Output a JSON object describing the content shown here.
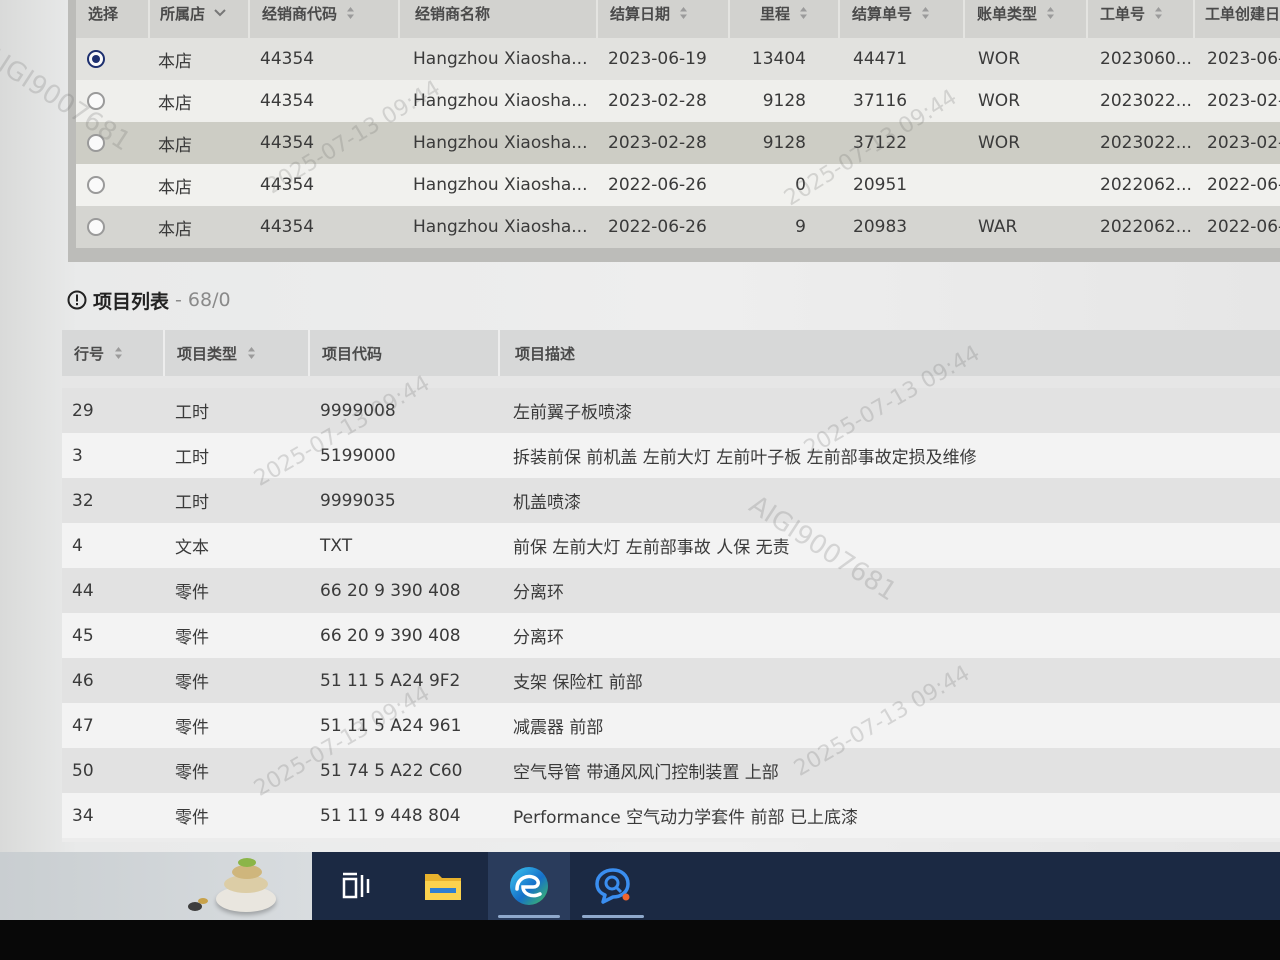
{
  "top_table": {
    "columns": [
      {
        "label": "选择",
        "sortable": false,
        "filter": false
      },
      {
        "label": "所属店",
        "sortable": false,
        "filter": true
      },
      {
        "label": "经销商代码",
        "sortable": true,
        "filter": false
      },
      {
        "label": "经销商名称",
        "sortable": false,
        "filter": false
      },
      {
        "label": "结算日期",
        "sortable": true,
        "filter": false
      },
      {
        "label": "里程",
        "sortable": true,
        "filter": false
      },
      {
        "label": "结算单号",
        "sortable": true,
        "filter": false
      },
      {
        "label": "账单类型",
        "sortable": true,
        "filter": false
      },
      {
        "label": "工单号",
        "sortable": true,
        "filter": false
      },
      {
        "label": "工单创建日",
        "sortable": false,
        "filter": false
      }
    ],
    "rows": [
      {
        "selected": true,
        "store": "本店",
        "dealer_code": "44354",
        "dealer_name": "Hangzhou Xiaosha...",
        "settle_date": "2023-06-19",
        "mileage": "13404",
        "settle_no": "44471",
        "bill_type": "WOR",
        "wo_no": "2023060...",
        "wo_created": "2023-06-"
      },
      {
        "selected": false,
        "store": "本店",
        "dealer_code": "44354",
        "dealer_name": "Hangzhou Xiaosha...",
        "settle_date": "2023-02-28",
        "mileage": "9128",
        "settle_no": "37116",
        "bill_type": "WOR",
        "wo_no": "2023022...",
        "wo_created": "2023-02-"
      },
      {
        "selected": false,
        "store": "本店",
        "dealer_code": "44354",
        "dealer_name": "Hangzhou Xiaosha...",
        "settle_date": "2023-02-28",
        "mileage": "9128",
        "settle_no": "37122",
        "bill_type": "WOR",
        "wo_no": "2023022...",
        "wo_created": "2023-02-"
      },
      {
        "selected": false,
        "store": "本店",
        "dealer_code": "44354",
        "dealer_name": "Hangzhou Xiaosha...",
        "settle_date": "2022-06-26",
        "mileage": "0",
        "settle_no": "20951",
        "bill_type": "",
        "wo_no": "2022062...",
        "wo_created": "2022-06-"
      },
      {
        "selected": false,
        "store": "本店",
        "dealer_code": "44354",
        "dealer_name": "Hangzhou Xiaosha...",
        "settle_date": "2022-06-26",
        "mileage": "9",
        "settle_no": "20983",
        "bill_type": "WAR",
        "wo_no": "2022062...",
        "wo_created": "2022-06-"
      }
    ]
  },
  "items_section": {
    "title": "项目列表",
    "count": "- 68/0",
    "icon": "exclamation-circle-icon"
  },
  "items_table": {
    "columns": [
      {
        "label": "行号",
        "sortable": true
      },
      {
        "label": "项目类型",
        "sortable": true
      },
      {
        "label": "项目代码",
        "sortable": false
      },
      {
        "label": "项目描述",
        "sortable": false
      }
    ],
    "rows": [
      {
        "line": "29",
        "type": "工时",
        "code": "9999008",
        "desc": "左前翼子板喷漆"
      },
      {
        "line": "3",
        "type": "工时",
        "code": "5199000",
        "desc": "拆装前保 前机盖 左前大灯 左前叶子板 左前部事故定损及维修"
      },
      {
        "line": "32",
        "type": "工时",
        "code": "9999035",
        "desc": "机盖喷漆"
      },
      {
        "line": "4",
        "type": "文本",
        "code": "TXT",
        "desc": "前保 左前大灯 左前部事故 人保 无责"
      },
      {
        "line": "44",
        "type": "零件",
        "code": "66 20 9 390 408",
        "desc": "分离环"
      },
      {
        "line": "45",
        "type": "零件",
        "code": "66 20 9 390 408",
        "desc": "分离环"
      },
      {
        "line": "46",
        "type": "零件",
        "code": "51 11 5 A24 9F2",
        "desc": "支架 保险杠 前部"
      },
      {
        "line": "47",
        "type": "零件",
        "code": "51 11 5 A24 961",
        "desc": "减震器 前部"
      },
      {
        "line": "50",
        "type": "零件",
        "code": "51 74 5 A22 C60",
        "desc": "空气导管 带通风风门控制装置 上部"
      },
      {
        "line": "34",
        "type": "零件",
        "code": "51 11 9 448 804",
        "desc": "Performance 空气动力学套件 前部 已上底漆"
      }
    ]
  },
  "taskbar": {
    "widget_icon": "stones-widget-icon",
    "icons": [
      "task-view-icon",
      "file-explorer-icon",
      "edge-browser-icon",
      "chat-search-icon"
    ],
    "active_icon": "edge-browser-icon"
  },
  "watermark": {
    "id_text": "AIGI9007681",
    "time_text": "2025-07-13 09:44"
  },
  "colors": {
    "selected_radio": "#1d2f6f",
    "taskbar_bg": "#1b2943",
    "header_bg": "#d2d2cf"
  }
}
